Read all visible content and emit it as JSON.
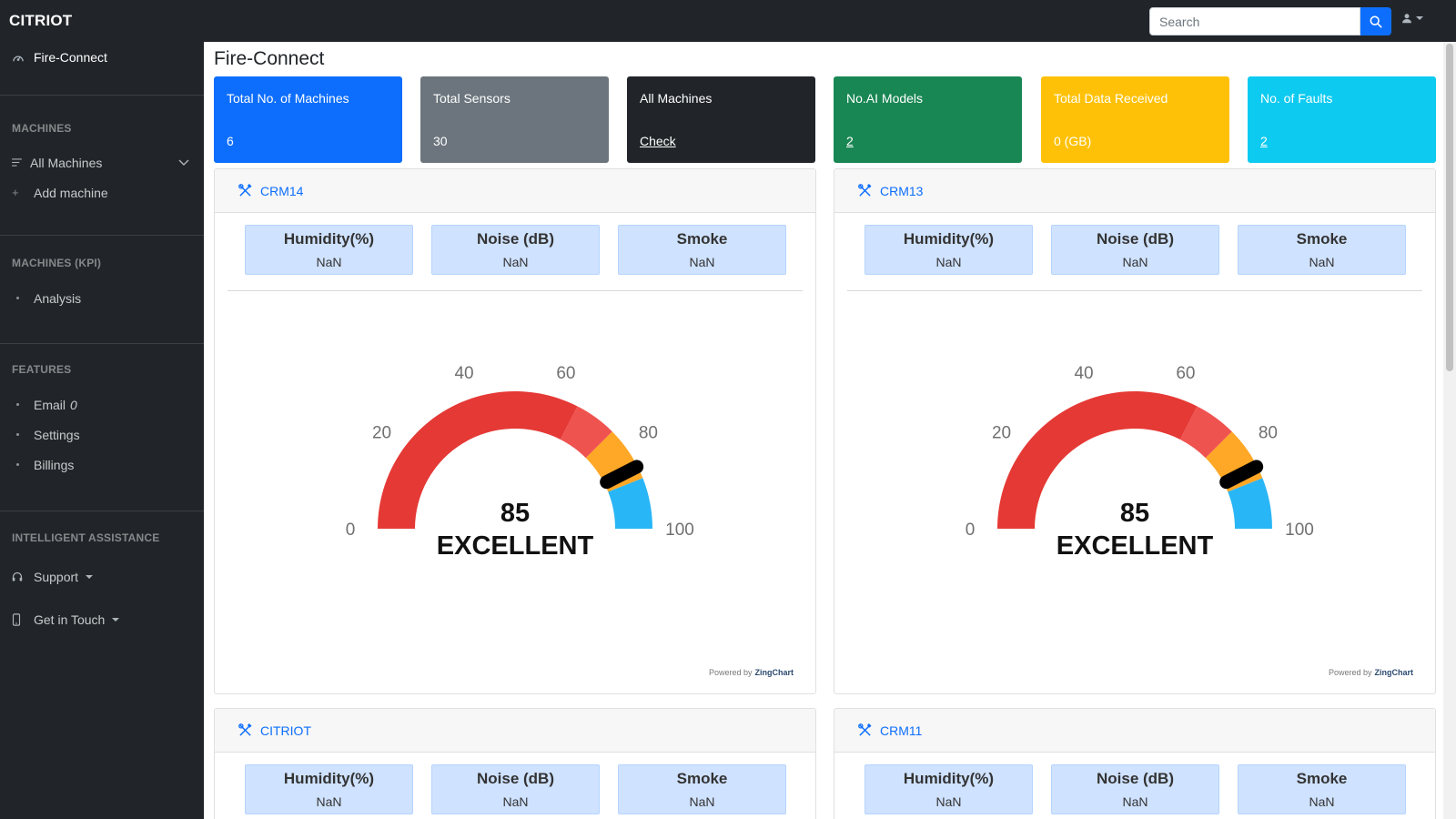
{
  "brand": "CITRIOT",
  "search": {
    "placeholder": "Search"
  },
  "colors": {
    "navbar": "#212529",
    "primary": "#0d6efd",
    "secondary": "#6c757d",
    "dark": "#212529",
    "success": "#198754",
    "warning": "#ffc107",
    "info": "#0dcaf0",
    "gauge_red": "#e53935",
    "gauge_orange": "#ffa726",
    "gauge_blue": "#29b6f6"
  },
  "sidebar": {
    "top_item": {
      "label": "Fire-Connect",
      "icon": "fire-connect-icon"
    },
    "sections": [
      {
        "heading": "MACHINES",
        "items": [
          {
            "label": "All Machines",
            "icon": "list-icon",
            "expandable": true
          },
          {
            "label": "Add machine",
            "icon": "plus-icon"
          }
        ]
      },
      {
        "heading": "MACHINES (KPI)",
        "items": [
          {
            "label": "Analysis",
            "icon": "dot-icon"
          }
        ]
      },
      {
        "heading": "FEATURES",
        "items": [
          {
            "label": "Email",
            "badge": "0",
            "icon": "dot-icon"
          },
          {
            "label": "Settings",
            "icon": "dot-icon"
          },
          {
            "label": "Billings",
            "icon": "dot-icon"
          }
        ]
      },
      {
        "heading": "INTELLIGENT ASSISTANCE",
        "items": [
          {
            "label": "Support",
            "icon": "headset-icon",
            "dropdown": true
          },
          {
            "label": "Get in Touch",
            "icon": "phone-icon",
            "dropdown": true
          }
        ]
      }
    ]
  },
  "main": {
    "title": "Fire-Connect",
    "stats": [
      {
        "label": "Total No. of Machines",
        "value": "6",
        "link": false,
        "color": "#0d6efd",
        "text": "#ffffff"
      },
      {
        "label": "Total Sensors",
        "value": "30",
        "link": false,
        "color": "#6c757d",
        "text": "#ffffff"
      },
      {
        "label": "All Machines",
        "value": "Check",
        "link": true,
        "color": "#212529",
        "text": "#ffffff"
      },
      {
        "label": "No.AI Models",
        "value": "2",
        "link": true,
        "color": "#198754",
        "text": "#ffffff"
      },
      {
        "label": "Total Data Received",
        "value": "0 (GB)",
        "link": false,
        "color": "#ffc107",
        "text": "#ffffff"
      },
      {
        "label": "No. of Faults",
        "value": "2",
        "link": true,
        "color": "#0dcaf0",
        "text": "#ffffff"
      }
    ],
    "machines": [
      {
        "name": "CRM14",
        "icon": "tools-icon",
        "metrics": [
          {
            "title": "Humidity(%)",
            "value": "NaN"
          },
          {
            "title": "Noise (dB)",
            "value": "NaN"
          },
          {
            "title": "Smoke",
            "value": "NaN"
          }
        ],
        "gauge": {
          "value": 85,
          "status": "EXCELLENT",
          "min": 0,
          "max": 100,
          "ticks": [
            "0",
            "20",
            "40",
            "60",
            "80",
            "100"
          ]
        },
        "powered_by": "Powered by",
        "powered_brand": "ZingChart"
      },
      {
        "name": "CRM13",
        "icon": "tools-icon",
        "metrics": [
          {
            "title": "Humidity(%)",
            "value": "NaN"
          },
          {
            "title": "Noise (dB)",
            "value": "NaN"
          },
          {
            "title": "Smoke",
            "value": "NaN"
          }
        ],
        "gauge": {
          "value": 85,
          "status": "EXCELLENT",
          "min": 0,
          "max": 100,
          "ticks": [
            "0",
            "20",
            "40",
            "60",
            "80",
            "100"
          ]
        },
        "powered_by": "Powered by",
        "powered_brand": "ZingChart"
      },
      {
        "name": "CITRIOT",
        "icon": "tools-icon",
        "metrics": [
          {
            "title": "Humidity(%)",
            "value": "NaN"
          },
          {
            "title": "Noise (dB)",
            "value": "NaN"
          },
          {
            "title": "Smoke",
            "value": "NaN"
          }
        ]
      },
      {
        "name": "CRM11",
        "icon": "tools-icon",
        "metrics": [
          {
            "title": "Humidity(%)",
            "value": "NaN"
          },
          {
            "title": "Noise (dB)",
            "value": "NaN"
          },
          {
            "title": "Smoke",
            "value": "NaN"
          }
        ]
      }
    ]
  }
}
